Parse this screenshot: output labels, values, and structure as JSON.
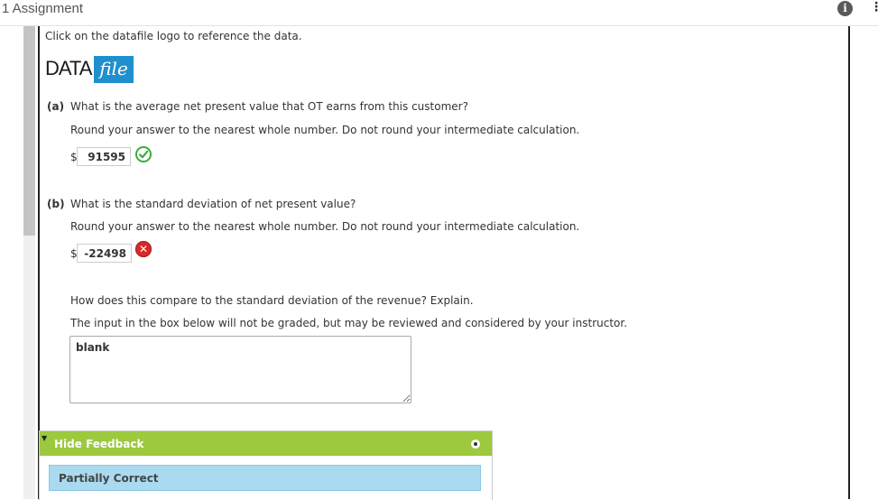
{
  "header": {
    "title": "1 Assignment"
  },
  "intro": "Click on the datafile logo to reference the data.",
  "logo": {
    "part1": "DATA",
    "part2": "file"
  },
  "part_a": {
    "tag": "(a)",
    "question": "What is the average net present value that OT earns from this customer?",
    "instruction": "Round your answer to the nearest whole number. Do not round your intermediate calculation.",
    "currency": "$",
    "answer": "91595",
    "status": "correct"
  },
  "part_b": {
    "tag": "(b)",
    "question": "What is the standard deviation of net present value?",
    "instruction": "Round your answer to the nearest whole number. Do not round your intermediate calculation.",
    "currency": "$",
    "answer": "-22498",
    "status": "incorrect"
  },
  "compare": {
    "question": "How does this compare to the standard deviation of the revenue? Explain.",
    "note": "The input in the box below will not be graded, but may be reviewed and considered by your instructor.",
    "textarea_value": "blank"
  },
  "feedback": {
    "toggle_label": "Hide Feedback",
    "status": "Partially Correct"
  },
  "colors": {
    "feedback_header": "#9dc93f",
    "status_bg": "#a9daf0",
    "logo_blue": "#1f8fce",
    "correct": "#3aae3a",
    "incorrect": "#d62a2a"
  }
}
